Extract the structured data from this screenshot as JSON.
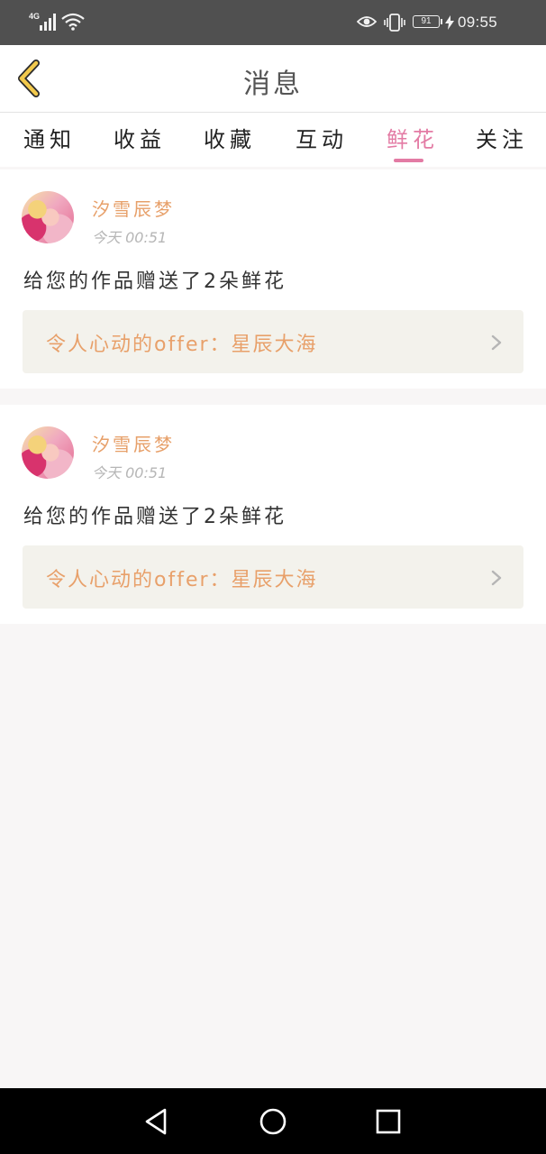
{
  "status_bar": {
    "network": "4G",
    "battery": "91",
    "time": "09:55"
  },
  "header": {
    "title": "消息"
  },
  "tabs": [
    {
      "label": "通知"
    },
    {
      "label": "收益"
    },
    {
      "label": "收藏"
    },
    {
      "label": "互动"
    },
    {
      "label": "鲜花",
      "active": true
    },
    {
      "label": "关注"
    }
  ],
  "messages": [
    {
      "user": "汐雪辰梦",
      "time": "今天 00:51",
      "text": "给您的作品赠送了2朵鲜花",
      "work_title": "令人心动的offer：星辰大海"
    },
    {
      "user": "汐雪辰梦",
      "time": "今天 00:51",
      "text": "给您的作品赠送了2朵鲜花",
      "work_title": "令人心动的offer：星辰大海"
    }
  ],
  "colors": {
    "accent_pink": "#e37ba4",
    "username_orange": "#e7a06a",
    "back_arrow": "#f2c94c"
  },
  "icons": {
    "back": "chevron-left-icon",
    "link": "chevron-right-icon",
    "nav": [
      "triangle-back-icon",
      "circle-home-icon",
      "square-recents-icon"
    ]
  }
}
